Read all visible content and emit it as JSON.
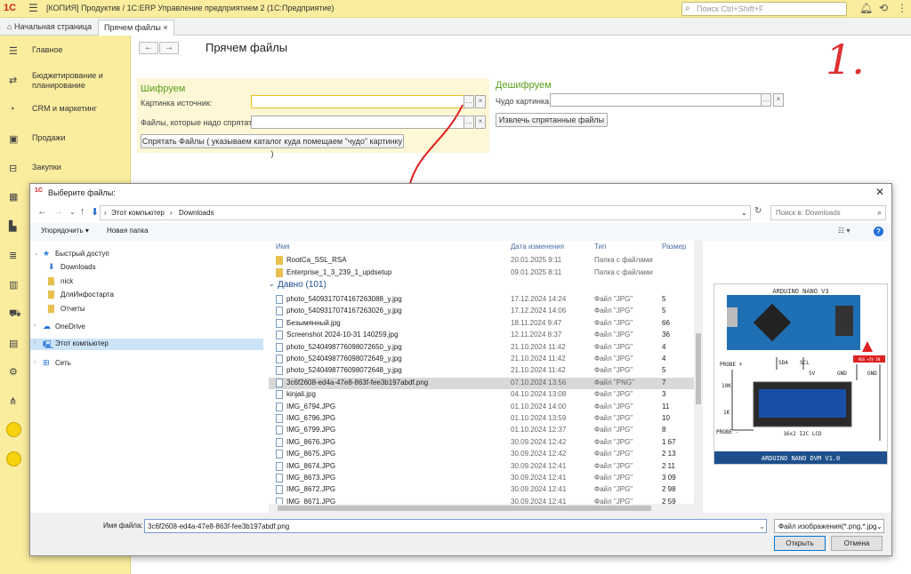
{
  "titlebar": {
    "logo": "1С",
    "title": "[КОПИЯ] Продуктив / 1С:ERP Управление предприятием 2  (1С:Предприятие)",
    "search_placeholder": "Поиск Ctrl+Shift+F"
  },
  "tabs": [
    {
      "label": "Начальная страница"
    },
    {
      "label": "Прячем файлы"
    }
  ],
  "sidebar": {
    "items": [
      {
        "label": "Главное",
        "icon": "menu-icon"
      },
      {
        "label": "Бюджетирование и планирование",
        "icon": "chart-icon"
      },
      {
        "label": "CRM и маркетинг",
        "icon": "pie-icon"
      },
      {
        "label": "Продажи",
        "icon": "bag-icon"
      },
      {
        "label": "Закупки",
        "icon": "cart-icon"
      }
    ]
  },
  "page": {
    "title": "Прячем файлы",
    "annotation": "1."
  },
  "encrypt": {
    "title": "Шифруем",
    "source_label": "Картинка источник:",
    "files_label": "Файлы, которые надо спрятать:",
    "hide_button": "Спрятать Файлы ( указываем каталог куда помещаем \"чудо\" картинку )"
  },
  "decrypt": {
    "title": "Дешифруем",
    "picture_label": "Чудо картинка:",
    "extract_button": "Извлечь спрятанные файлы"
  },
  "dialog": {
    "title": "Выберите файлы:",
    "path": [
      "Этот компьютер",
      "Downloads"
    ],
    "search_placeholder": "Поиск в: Downloads",
    "organize": "Упорядочить",
    "new_folder": "Новая папка",
    "tree": [
      {
        "label": "Быстрый доступ"
      },
      {
        "label": "Downloads"
      },
      {
        "label": "nick"
      },
      {
        "label": "ДляИнфостарта"
      },
      {
        "label": "Отчеты"
      },
      {
        "label": "OneDrive"
      },
      {
        "label": "Этот компьютер"
      },
      {
        "label": "Сеть"
      }
    ],
    "columns": [
      "Имя",
      "Дата изменения",
      "Тип",
      "Размер"
    ],
    "folders": [
      {
        "name": "RootCa_SSL_RSA",
        "date": "20.01.2025 9:11",
        "type": "Папка с файлами",
        "size": ""
      },
      {
        "name": "Enterprise_1_3_239_1_updsetup",
        "date": "09.01.2025 8:11",
        "type": "Папка с файлами",
        "size": ""
      }
    ],
    "group": "Давно (101)",
    "files": [
      {
        "name": "photo_5409317074167263088_y.jpg",
        "date": "17.12.2024 14:24",
        "type": "Файл \"JPG\"",
        "size": "5"
      },
      {
        "name": "photo_5409317074167263026_y.jpg",
        "date": "17.12.2024 14:06",
        "type": "Файл \"JPG\"",
        "size": "5"
      },
      {
        "name": "Безымянный.jpg",
        "date": "18.11.2024 9:47",
        "type": "Файл \"JPG\"",
        "size": "66"
      },
      {
        "name": "Screenshot 2024-10-31 140259.jpg",
        "date": "12.11.2024 8:37",
        "type": "Файл \"JPG\"",
        "size": "36"
      },
      {
        "name": "photo_5240498776098072650_y.jpg",
        "date": "21.10.2024 11:42",
        "type": "Файл \"JPG\"",
        "size": "4"
      },
      {
        "name": "photo_5240498776098072649_y.jpg",
        "date": "21.10.2024 11:42",
        "type": "Файл \"JPG\"",
        "size": "4"
      },
      {
        "name": "photo_5240498776098072648_y.jpg",
        "date": "21.10.2024 11:42",
        "type": "Файл \"JPG\"",
        "size": "5"
      },
      {
        "name": "3c6f2608-ed4a-47e8-863f-fee3b197abdf.png",
        "date": "07.10.2024 13:56",
        "type": "Файл \"PNG\"",
        "size": "7"
      },
      {
        "name": "kinjali.jpg",
        "date": "04.10.2024 13:08",
        "type": "Файл \"JPG\"",
        "size": "3"
      },
      {
        "name": "IMG_6794.JPG",
        "date": "01.10.2024 14:00",
        "type": "Файл \"JPG\"",
        "size": "11"
      },
      {
        "name": "IMG_6796.JPG",
        "date": "01.10.2024 13:59",
        "type": "Файл \"JPG\"",
        "size": "10"
      },
      {
        "name": "IMG_6799.JPG",
        "date": "01.10.2024 12:37",
        "type": "Файл \"JPG\"",
        "size": "8"
      },
      {
        "name": "IMG_8676.JPG",
        "date": "30.09.2024 12:42",
        "type": "Файл \"JPG\"",
        "size": "1 67"
      },
      {
        "name": "IMG_8675.JPG",
        "date": "30.09.2024 12:42",
        "type": "Файл \"JPG\"",
        "size": "2 13"
      },
      {
        "name": "IMG_8674.JPG",
        "date": "30.09.2024 12:41",
        "type": "Файл \"JPG\"",
        "size": "2 11"
      },
      {
        "name": "IMG_8673.JPG",
        "date": "30.09.2024 12:41",
        "type": "Файл \"JPG\"",
        "size": "3 09"
      },
      {
        "name": "IMG_8672.JPG",
        "date": "30.09.2024 12:41",
        "type": "Файл \"JPG\"",
        "size": "2 98"
      },
      {
        "name": "IMG_8671.JPG",
        "date": "30.09.2024 12:41",
        "type": "Файл \"JPG\"",
        "size": "2 59"
      }
    ],
    "selected_index": 7,
    "preview": {
      "header": "ARDUINO NANO V3",
      "footer": "ARDUINO NANO DVM V1.0",
      "lcd": "16x2 I2C LCD",
      "labels": [
        "PROBE +",
        "PROBE -",
        "10K",
        "1K",
        "SDA",
        "SCL",
        "5V",
        "GND",
        "GND",
        "REG +5V IN"
      ]
    },
    "filename_label": "Имя файла:",
    "filename": "3c6f2608-ed4a-47e8-863f-fee3b197abdf.png",
    "filetype": "Файл изображения(*.png,*.jpg",
    "open_button": "Открыть",
    "cancel_button": "Отмена"
  }
}
